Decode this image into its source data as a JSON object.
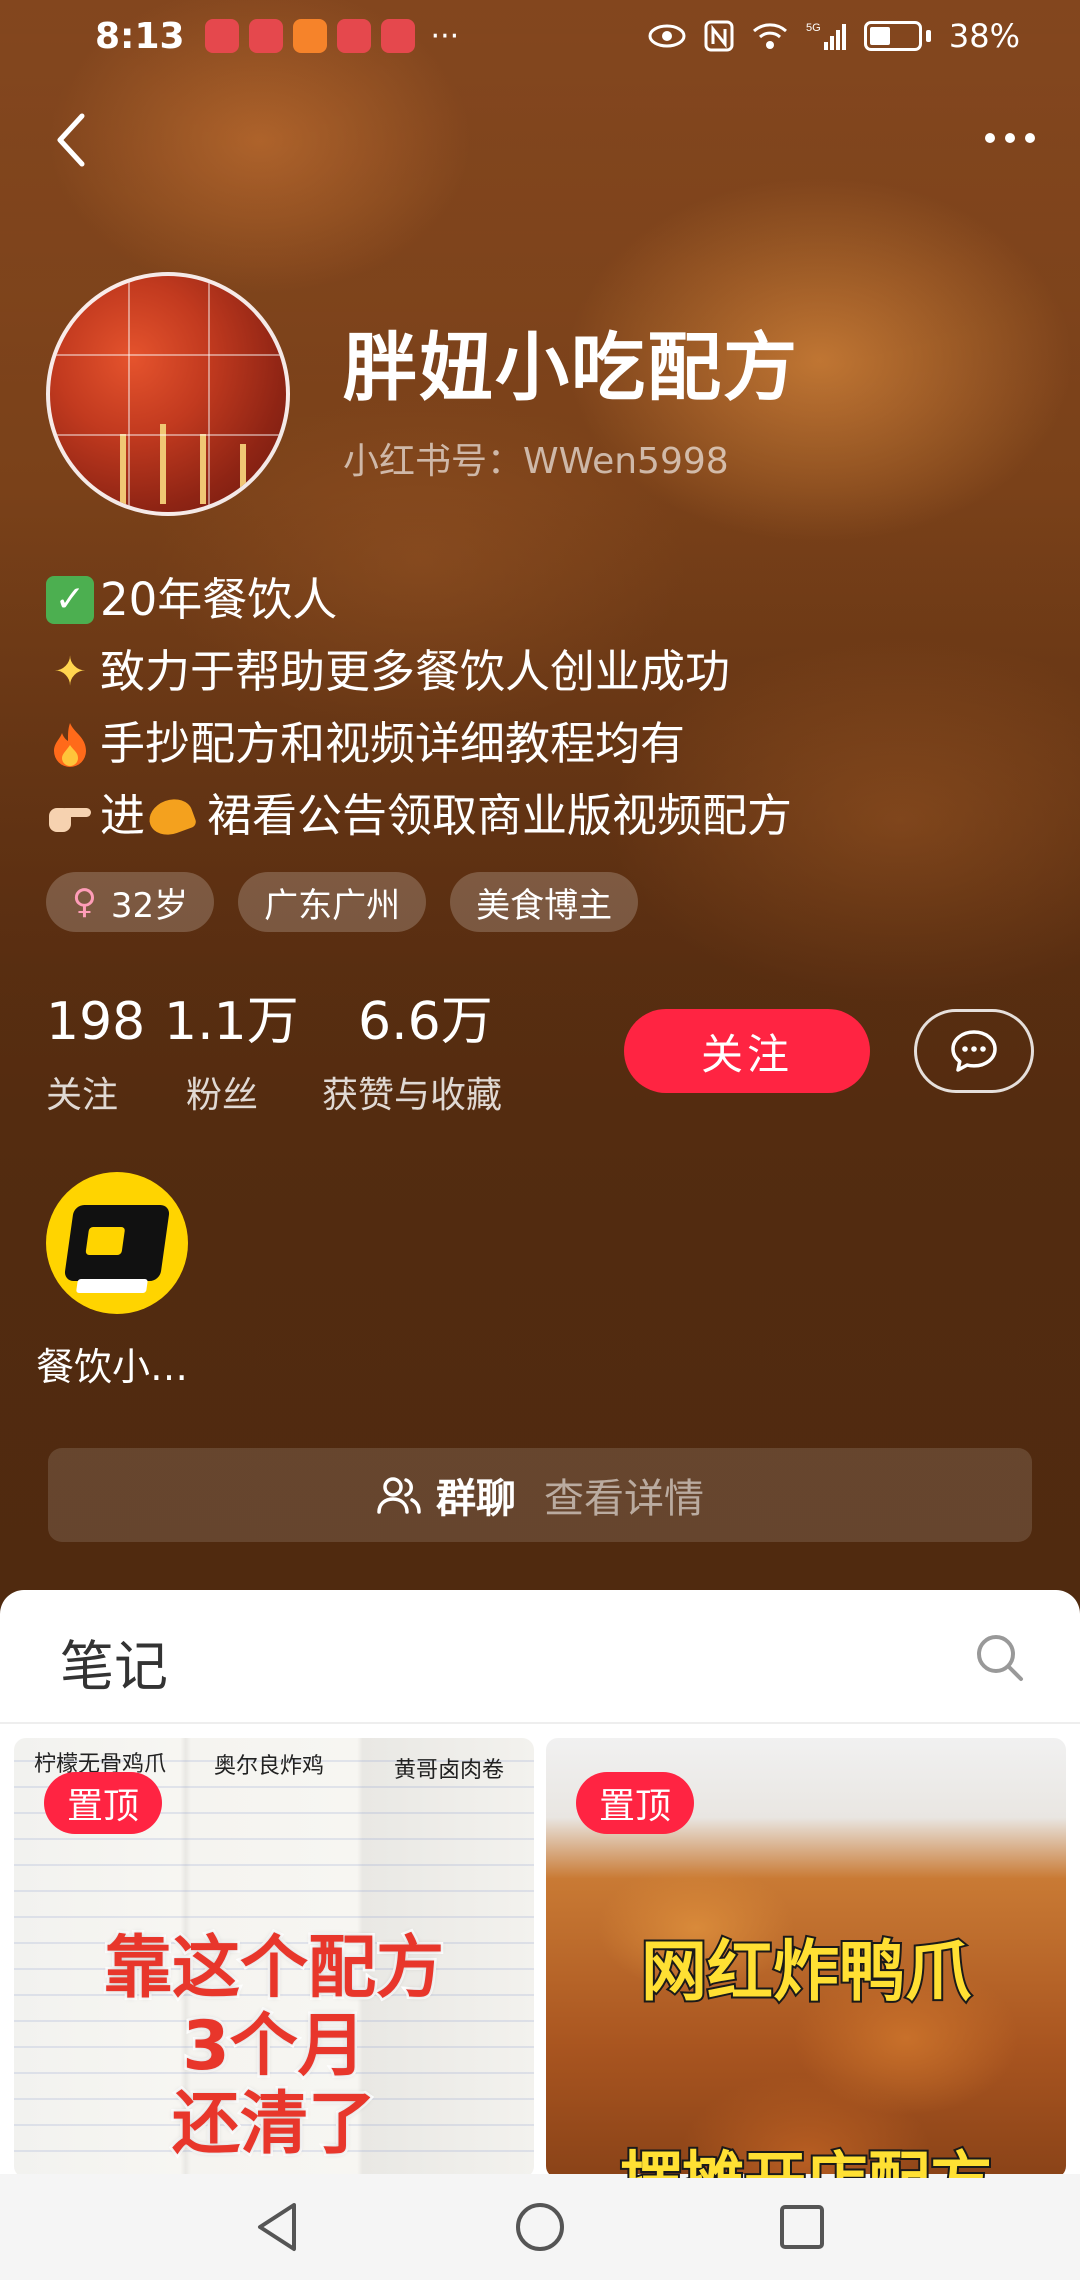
{
  "status_bar": {
    "time": "8:13",
    "app_icons": [
      "HUAWEI",
      "HUAWEI",
      "video",
      "HUAWEI",
      "小红书"
    ],
    "more": "···",
    "battery": "38%",
    "network": "5G"
  },
  "nav": {
    "back_icon": "chevron-left-icon",
    "more_icon": "more-horizontal-icon"
  },
  "profile": {
    "nickname": "胖妞小吃配方",
    "redbook_id": "小红书号：WWen5998",
    "bio": [
      {
        "emoji": "✅",
        "text": "20年餐饮人"
      },
      {
        "emoji": "✨",
        "text": "致力于帮助更多餐饮人创业成功"
      },
      {
        "emoji": "🔥",
        "text": "手抄配方和视频详细教程均有"
      },
      {
        "emoji": "👉🏻",
        "text_before": "进",
        "emoji2": "🥳",
        "text": "裙看公告领取商业版视频配方"
      }
    ],
    "tags": [
      {
        "icon": "♀",
        "label": "32岁"
      },
      {
        "label": "广东广州"
      },
      {
        "label": "美食博主"
      }
    ]
  },
  "stats": [
    {
      "value": "198",
      "label": "关注"
    },
    {
      "value": "1.1万",
      "label": "粉丝"
    },
    {
      "value": "6.6万",
      "label": "获赞与收藏"
    }
  ],
  "actions": {
    "follow_label": "关注",
    "chat_icon": "chat-bubble-icon"
  },
  "circle": {
    "name": "餐饮小…"
  },
  "group_chat": {
    "label": "群聊",
    "detail": "查看详情"
  },
  "notes": {
    "title": "笔记",
    "cards": [
      {
        "pinned": "置顶",
        "headings": [
          "柠檬无骨鸡爪",
          "奥尔良炸鸡",
          "黄哥卤肉卷"
        ],
        "headline": [
          "靠这个配方",
          "3个月",
          "还清了"
        ]
      },
      {
        "pinned": "置顶",
        "headline": [
          "网红炸鸭爪"
        ],
        "subline": "摆摊开店配方"
      }
    ]
  },
  "colors": {
    "accent": "#ff2442",
    "hero_brown": "#6a3816",
    "circle_yellow": "#ffd400"
  }
}
